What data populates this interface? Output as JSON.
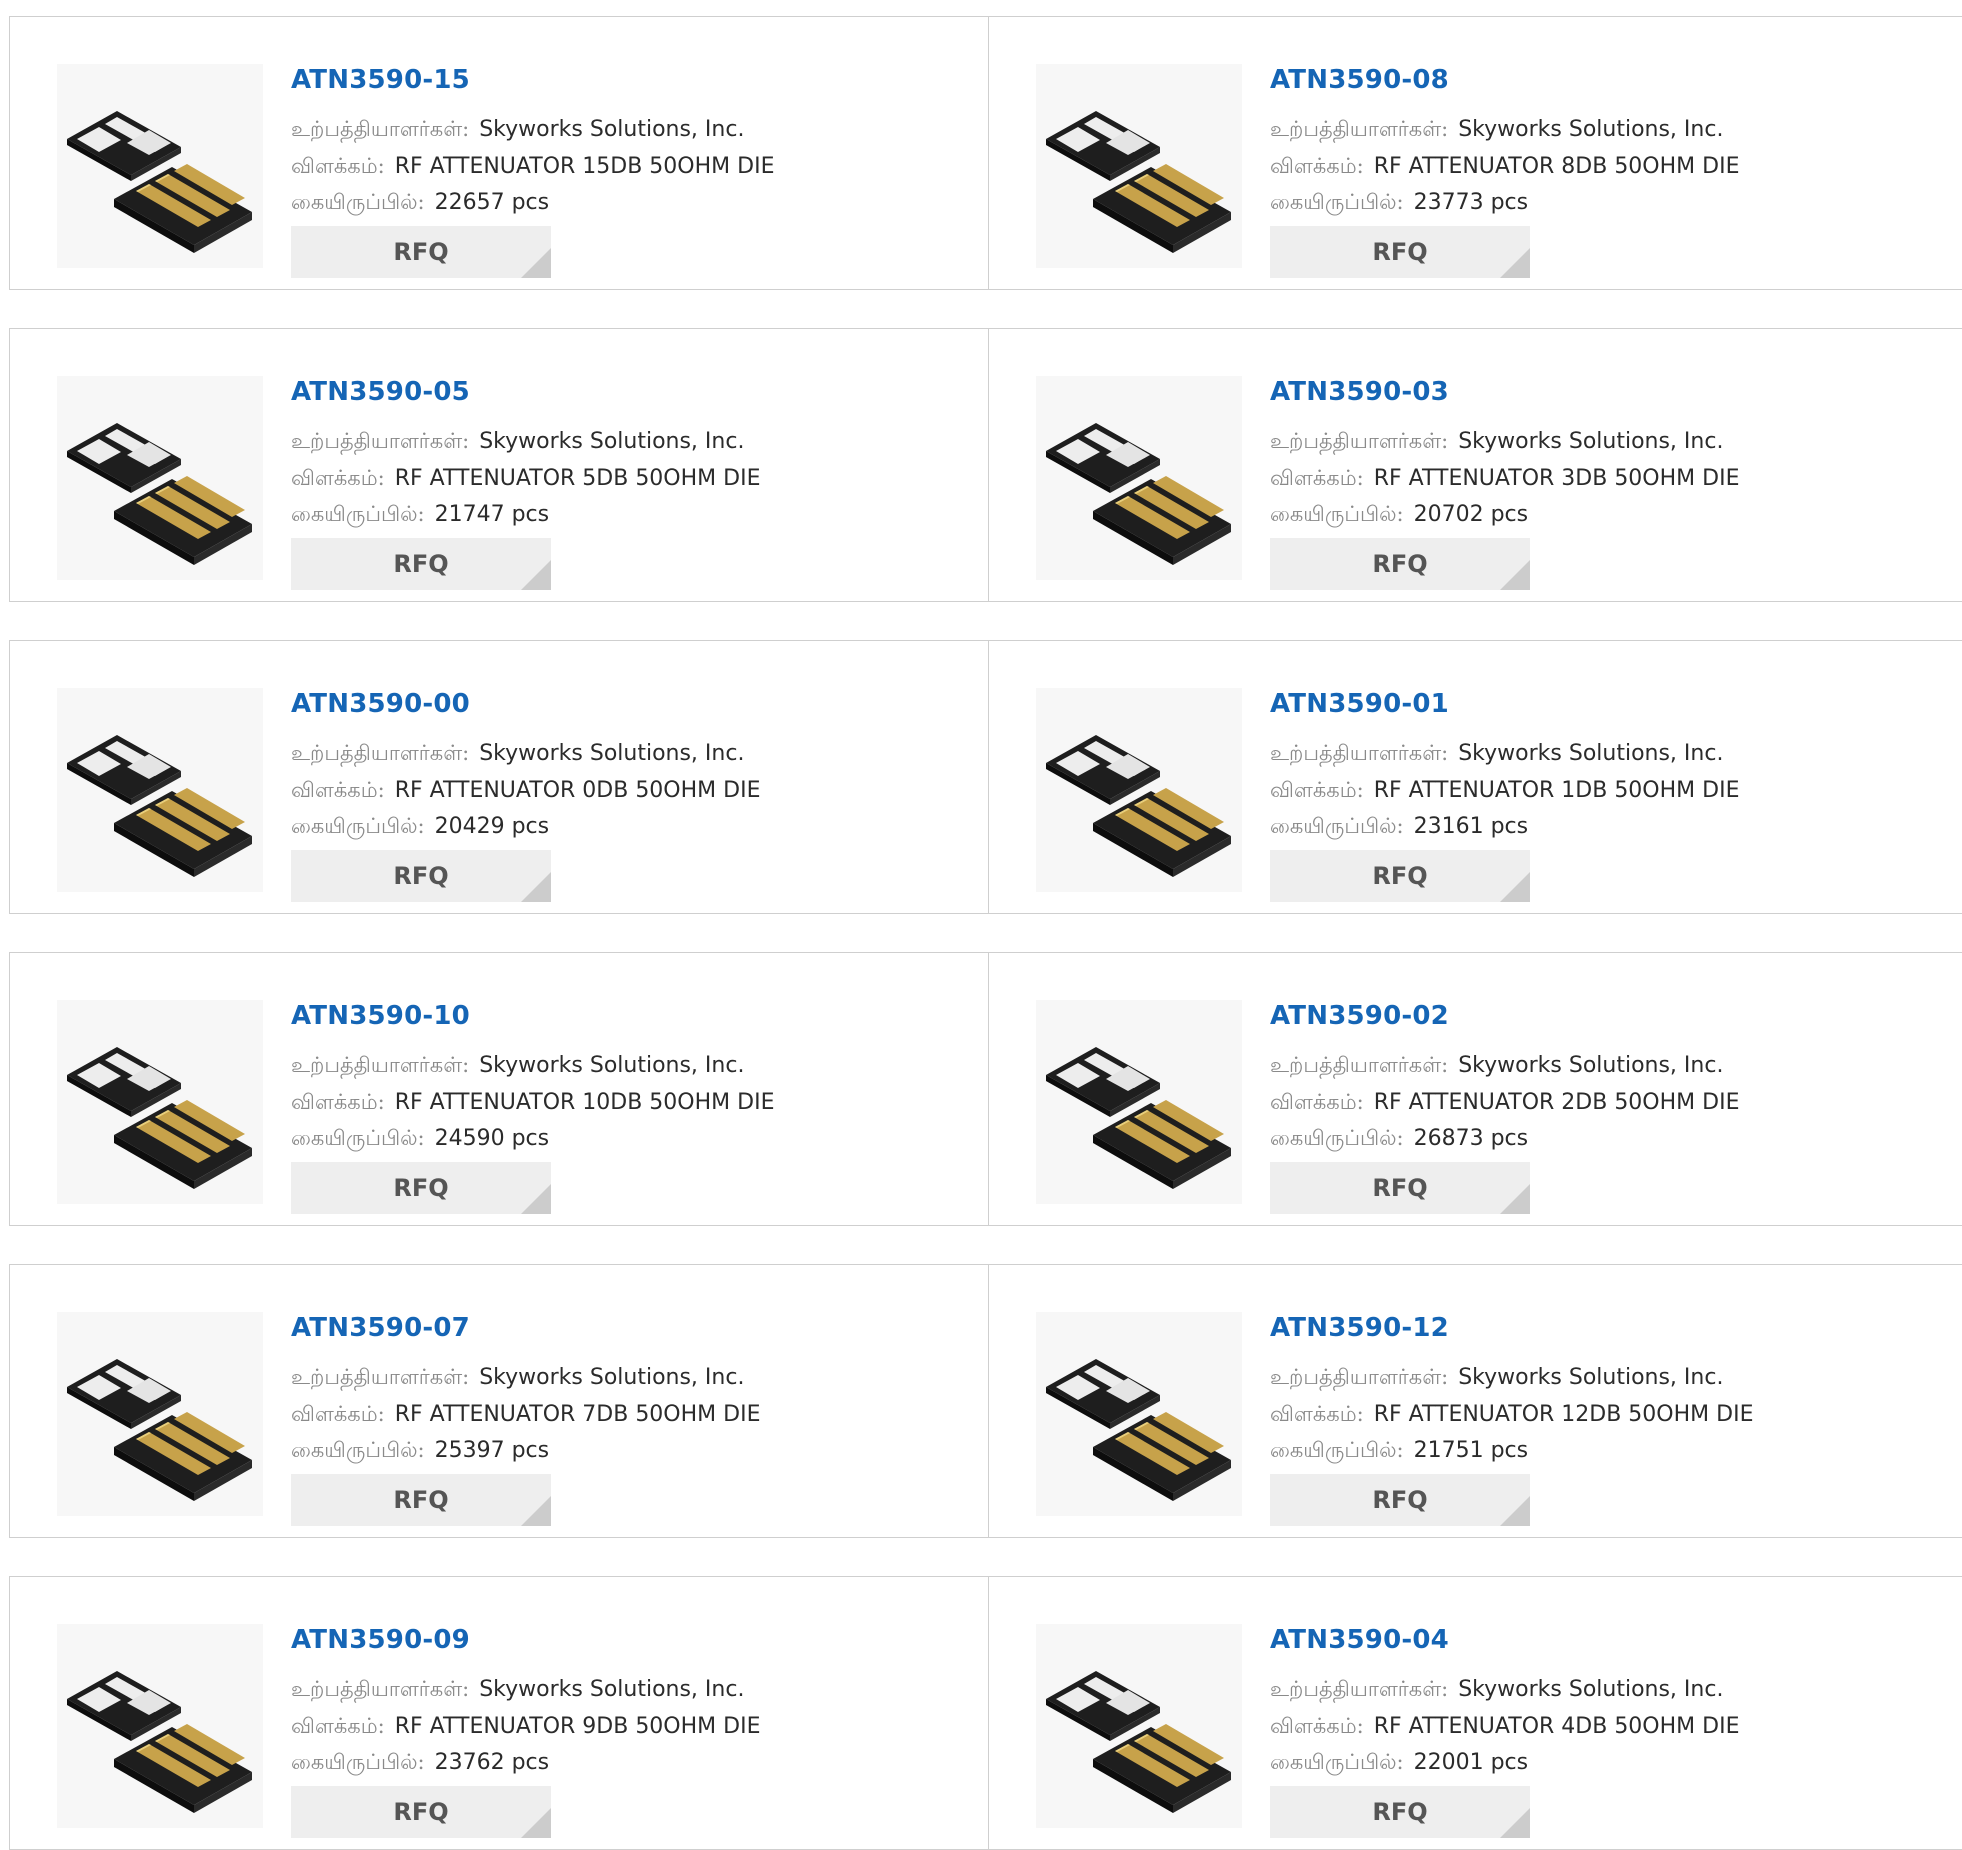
{
  "labels": {
    "manufacturer": "உற்பத்தியாளர்கள்:",
    "description": "விளக்கம்:",
    "stock": "கையிருப்பில்:",
    "rfq": "RFQ"
  },
  "colors": {
    "link": "#1565b5",
    "label": "#8a8a8a",
    "rfq_bg": "#eeeeee",
    "border": "#cfcfcf"
  },
  "products": [
    {
      "part": "ATN3590-15",
      "manufacturer": "Skyworks Solutions, Inc.",
      "description": "RF ATTENUATOR 15DB 50OHM DIE",
      "stock": "22657 pcs"
    },
    {
      "part": "ATN3590-08",
      "manufacturer": "Skyworks Solutions, Inc.",
      "description": "RF ATTENUATOR 8DB 50OHM DIE",
      "stock": "23773 pcs"
    },
    {
      "part": "ATN3590-05",
      "manufacturer": "Skyworks Solutions, Inc.",
      "description": "RF ATTENUATOR 5DB 50OHM DIE",
      "stock": "21747 pcs"
    },
    {
      "part": "ATN3590-03",
      "manufacturer": "Skyworks Solutions, Inc.",
      "description": "RF ATTENUATOR 3DB 50OHM DIE",
      "stock": "20702 pcs"
    },
    {
      "part": "ATN3590-00",
      "manufacturer": "Skyworks Solutions, Inc.",
      "description": "RF ATTENUATOR 0DB 50OHM DIE",
      "stock": "20429 pcs"
    },
    {
      "part": "ATN3590-01",
      "manufacturer": "Skyworks Solutions, Inc.",
      "description": "RF ATTENUATOR 1DB 50OHM DIE",
      "stock": "23161 pcs"
    },
    {
      "part": "ATN3590-10",
      "manufacturer": "Skyworks Solutions, Inc.",
      "description": "RF ATTENUATOR 10DB 50OHM DIE",
      "stock": "24590 pcs"
    },
    {
      "part": "ATN3590-02",
      "manufacturer": "Skyworks Solutions, Inc.",
      "description": "RF ATTENUATOR 2DB 50OHM DIE",
      "stock": "26873 pcs"
    },
    {
      "part": "ATN3590-07",
      "manufacturer": "Skyworks Solutions, Inc.",
      "description": "RF ATTENUATOR 7DB 50OHM DIE",
      "stock": "25397 pcs"
    },
    {
      "part": "ATN3590-12",
      "manufacturer": "Skyworks Solutions, Inc.",
      "description": "RF ATTENUATOR 12DB 50OHM DIE",
      "stock": "21751 pcs"
    },
    {
      "part": "ATN3590-09",
      "manufacturer": "Skyworks Solutions, Inc.",
      "description": "RF ATTENUATOR 9DB 50OHM DIE",
      "stock": "23762 pcs"
    },
    {
      "part": "ATN3590-04",
      "manufacturer": "Skyworks Solutions, Inc.",
      "description": "RF ATTENUATOR 4DB 50OHM DIE",
      "stock": "22001 pcs"
    }
  ]
}
